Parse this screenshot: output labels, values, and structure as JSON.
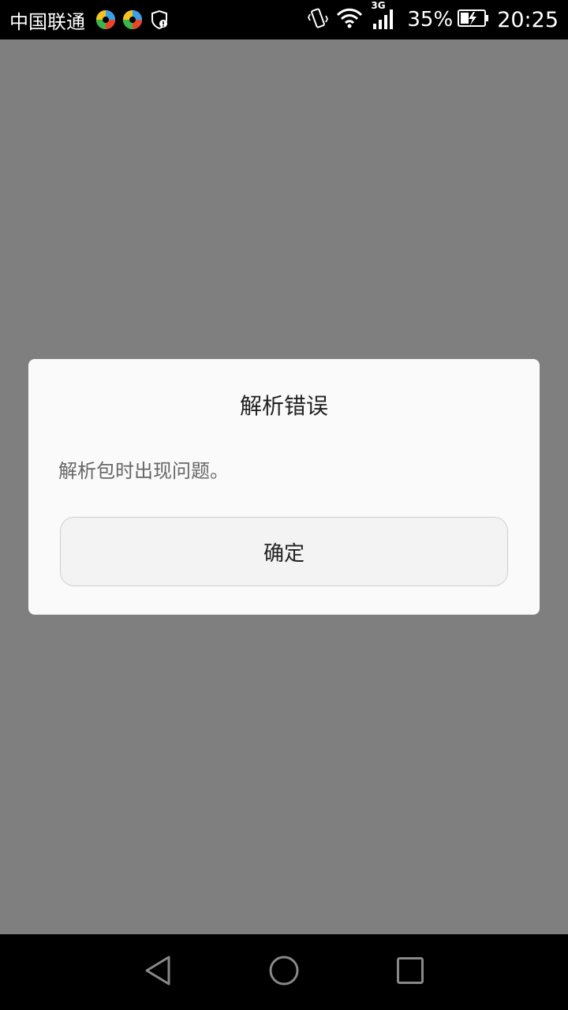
{
  "status_bar": {
    "carrier": "中国联通",
    "battery_percent": "35%",
    "time": "20:25",
    "network_label": "3G",
    "icons": [
      "app-swirl-icon",
      "app-swirl-icon",
      "shield-alert-icon",
      "vibrate-icon",
      "wifi-icon",
      "signal-icon",
      "battery-charging-icon"
    ]
  },
  "dialog": {
    "title": "解析错误",
    "message": "解析包时出现问题。",
    "confirm_label": "确定"
  },
  "nav_bar": {
    "icons": [
      "back-icon",
      "home-icon",
      "recents-icon"
    ]
  },
  "colors": {
    "scrim": "#7f7f7f",
    "dialog_bg": "#fafafa",
    "bars": "#000000"
  }
}
